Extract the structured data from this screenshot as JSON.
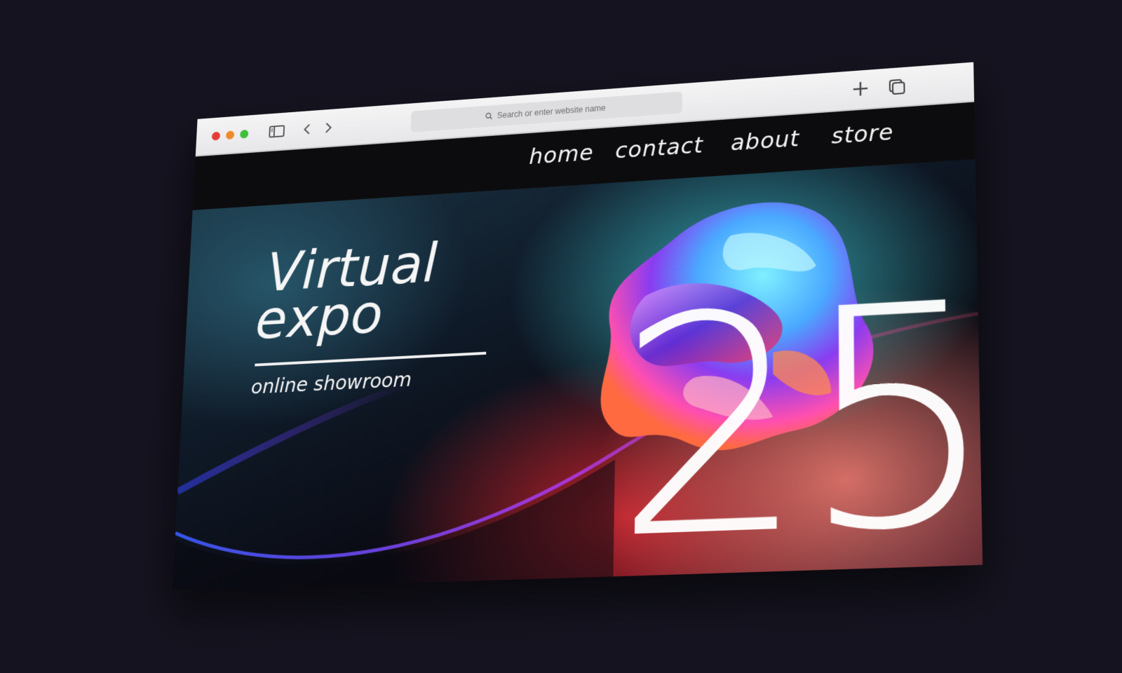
{
  "browser": {
    "address_placeholder": "Search or enter website name"
  },
  "nav": {
    "home": "home",
    "contact": "contact",
    "about": "about",
    "store": "store"
  },
  "hero": {
    "title_line1": "Virtual",
    "title_line2": "expo",
    "subtitle": "online showroom",
    "number": "25"
  },
  "colors": {
    "background": "#14131f",
    "navbar": "#0c0c0e",
    "teal": "#3cbec8",
    "red": "#dc2832",
    "violet": "#8a3cf0",
    "text": "#f5f5f5"
  },
  "icons": [
    "search-icon",
    "sidebar-icon",
    "chevron-left-icon",
    "chevron-right-icon",
    "plus-icon",
    "tabs-icon"
  ]
}
